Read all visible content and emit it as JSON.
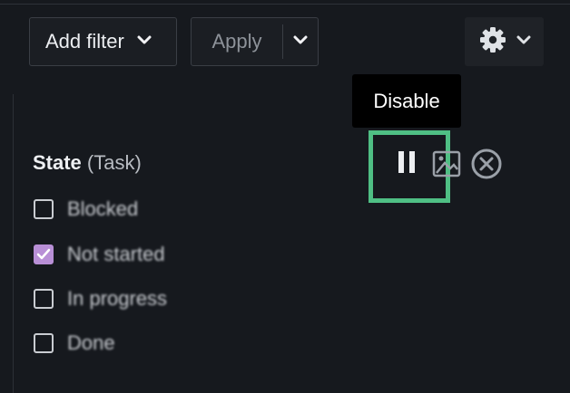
{
  "toolbar": {
    "add_filter_label": "Add filter",
    "apply_label": "Apply"
  },
  "tooltip": {
    "text": "Disable"
  },
  "filter": {
    "title_bold": "State",
    "title_paren": "(Task)",
    "options": [
      {
        "label": "Blocked",
        "checked": false
      },
      {
        "label": "Not started",
        "checked": true
      },
      {
        "label": "In progress",
        "checked": false
      },
      {
        "label": "Done",
        "checked": false
      }
    ]
  },
  "icons": {
    "add_filter_chevron": "chevron-down-icon",
    "apply_chevron": "chevron-down-icon",
    "settings": "gear-icon",
    "settings_chevron": "chevron-down-icon",
    "pause": "pause-icon",
    "image": "image-icon",
    "close": "close-circle-icon"
  },
  "colors": {
    "background": "#16191e",
    "highlight": "#4fbf84",
    "checkbox_checked": "#b88fd6",
    "tooltip_bg": "#000000"
  }
}
